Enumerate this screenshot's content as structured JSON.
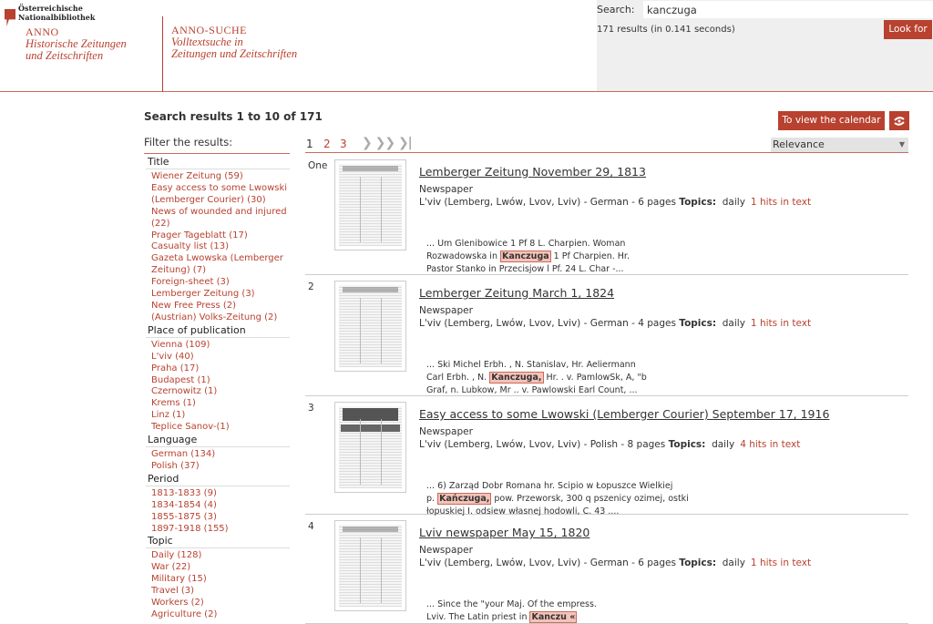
{
  "header": {
    "institution_line1": "Österreichische",
    "institution_line2": "Nationalbibliothek",
    "brand1_title": "ANNO",
    "brand1_sub1": "Historische Zeitungen",
    "brand1_sub2": "und Zeitschriften",
    "brand2_title": "ANNO-SUCHE",
    "brand2_sub1": "Volltextsuche in",
    "brand2_sub2": "Zeitungen und Zeitschriften"
  },
  "search": {
    "label": "Search:",
    "value": "kanczuga",
    "results_info": "171 results (in 0.141 seconds)",
    "button": "Look for"
  },
  "results_heading": "Search results 1 to 10 of 171",
  "calendar_button": "To view the calendar",
  "filter_title": "Filter the results:",
  "pagination": {
    "current": "1",
    "pages": [
      "2",
      "3"
    ],
    "arrows": "❯ ❯❯ ❯|"
  },
  "sort": {
    "selected": "Relevance"
  },
  "filters": [
    {
      "title": "Title",
      "items": [
        "Wiener Zeitung (59)",
        "Easy access to some Lwowski (Lemberger Courier) (30)",
        "News of wounded and injured (22)",
        "Prager Tageblatt (17)",
        "Casualty list (13)",
        "Gazeta Lwowska (Lemberger Zeitung) (7)",
        "Foreign-sheet (3)",
        "Lemberger Zeitung (3)",
        "New Free Press (2)",
        "(Austrian) Volks-Zeitung (2)"
      ]
    },
    {
      "title": "Place of publication",
      "items": [
        "Vienna (109)",
        "L'viv (40)",
        "Praha (17)",
        "Budapest (1)",
        "Czernowitz (1)",
        "Krems (1)",
        "Linz (1)",
        "Teplice Sanov-(1)"
      ]
    },
    {
      "title": "Language",
      "items": [
        "German (134)",
        "Polish (37)"
      ]
    },
    {
      "title": "Period",
      "items": [
        "1813-1833 (9)",
        "1834-1854 (4)",
        "1855-1875 (3)",
        "1897-1918 (155)"
      ]
    },
    {
      "title": "Topic",
      "items": [
        "Daily (128)",
        "War (22)",
        "Military (15)",
        "Travel (3)",
        "Workers (2)",
        "Agriculture (2)"
      ]
    }
  ],
  "results": [
    {
      "num": "One",
      "title": "Lemberger Zeitung November 29, 1813",
      "type": "Newspaper",
      "meta": "L'viv (Lemberg, Lwów, Lvov, Lviv) - German - 6 pages",
      "topics_label": "Topics:",
      "topics": "daily",
      "hits": "1 hits in text",
      "snippet_pre1": "... Um Glenibowice 1 Pf 8 L. Charpien. Woman",
      "snippet_pre2": "Rozwadowska in ",
      "highlight": "Kanczuga",
      "snippet_post2": " 1 Pf Charpien. Hr.",
      "snippet_line3": "Pastor Stanko in Przecisjow l Pf. 24 L. Char -..."
    },
    {
      "num": "2",
      "title": "Lemberger Zeitung March 1, 1824",
      "type": "Newspaper",
      "meta": "L'viv (Lemberg, Lwów, Lvov, Lviv) - German - 4 pages",
      "topics_label": "Topics:",
      "topics": "daily",
      "hits": "1 hits in text",
      "snippet_pre1": "... Ski Michel Erbh. , N. Stanislav, Hr. Aeliermann",
      "snippet_pre2": "Carl Erbh. , N. ",
      "highlight": "Kanczuga,",
      "snippet_post2": " Hr. . v. PamlowSk, A, \"b",
      "snippet_line3": "Graf, n. Lubkow, Mr .. v. Pawlowski Earl Count, ..."
    },
    {
      "num": "3",
      "title": "Easy access to some Lwowski (Lemberger Courier) September 17, 1916",
      "type": "Newspaper",
      "meta": "L'viv (Lemberg, Lwów, Lvov, Lviv) - Polish - 8 pages",
      "topics_label": "Topics:",
      "topics": "daily",
      "hits": "4 hits in text",
      "snippet_pre1": "... 6) Zarząd Dobr Romana hr. Scipio w Łopuszce Wielkiej",
      "snippet_pre2": "p. ",
      "highlight": "Kańczuga,",
      "snippet_post2": " pow. Przeworsk, 300 q pszenicy ozimej, ostki",
      "snippet_line3": "łopuskiej I. odsiew własnej hodowli, C. 43 ...."
    },
    {
      "num": "4",
      "title": "Lviv newspaper May 15, 1820",
      "type": "Newspaper",
      "meta": "L'viv (Lemberg, Lwów, Lvov, Lviv) - German - 6 pages",
      "topics_label": "Topics:",
      "topics": "daily",
      "hits": "1 hits in text",
      "snippet_pre1": "... Since the \"your Maj. Of the empress.",
      "snippet_pre2": "Lviv. The Latin priest in ",
      "highlight": "Kanczu «",
      "snippet_post2": "",
      "snippet_line3": ""
    }
  ],
  "colors": {
    "accent": "#b8412f",
    "highlight_bg": "#f4c2b8",
    "search_panel_bg": "#efefef"
  }
}
